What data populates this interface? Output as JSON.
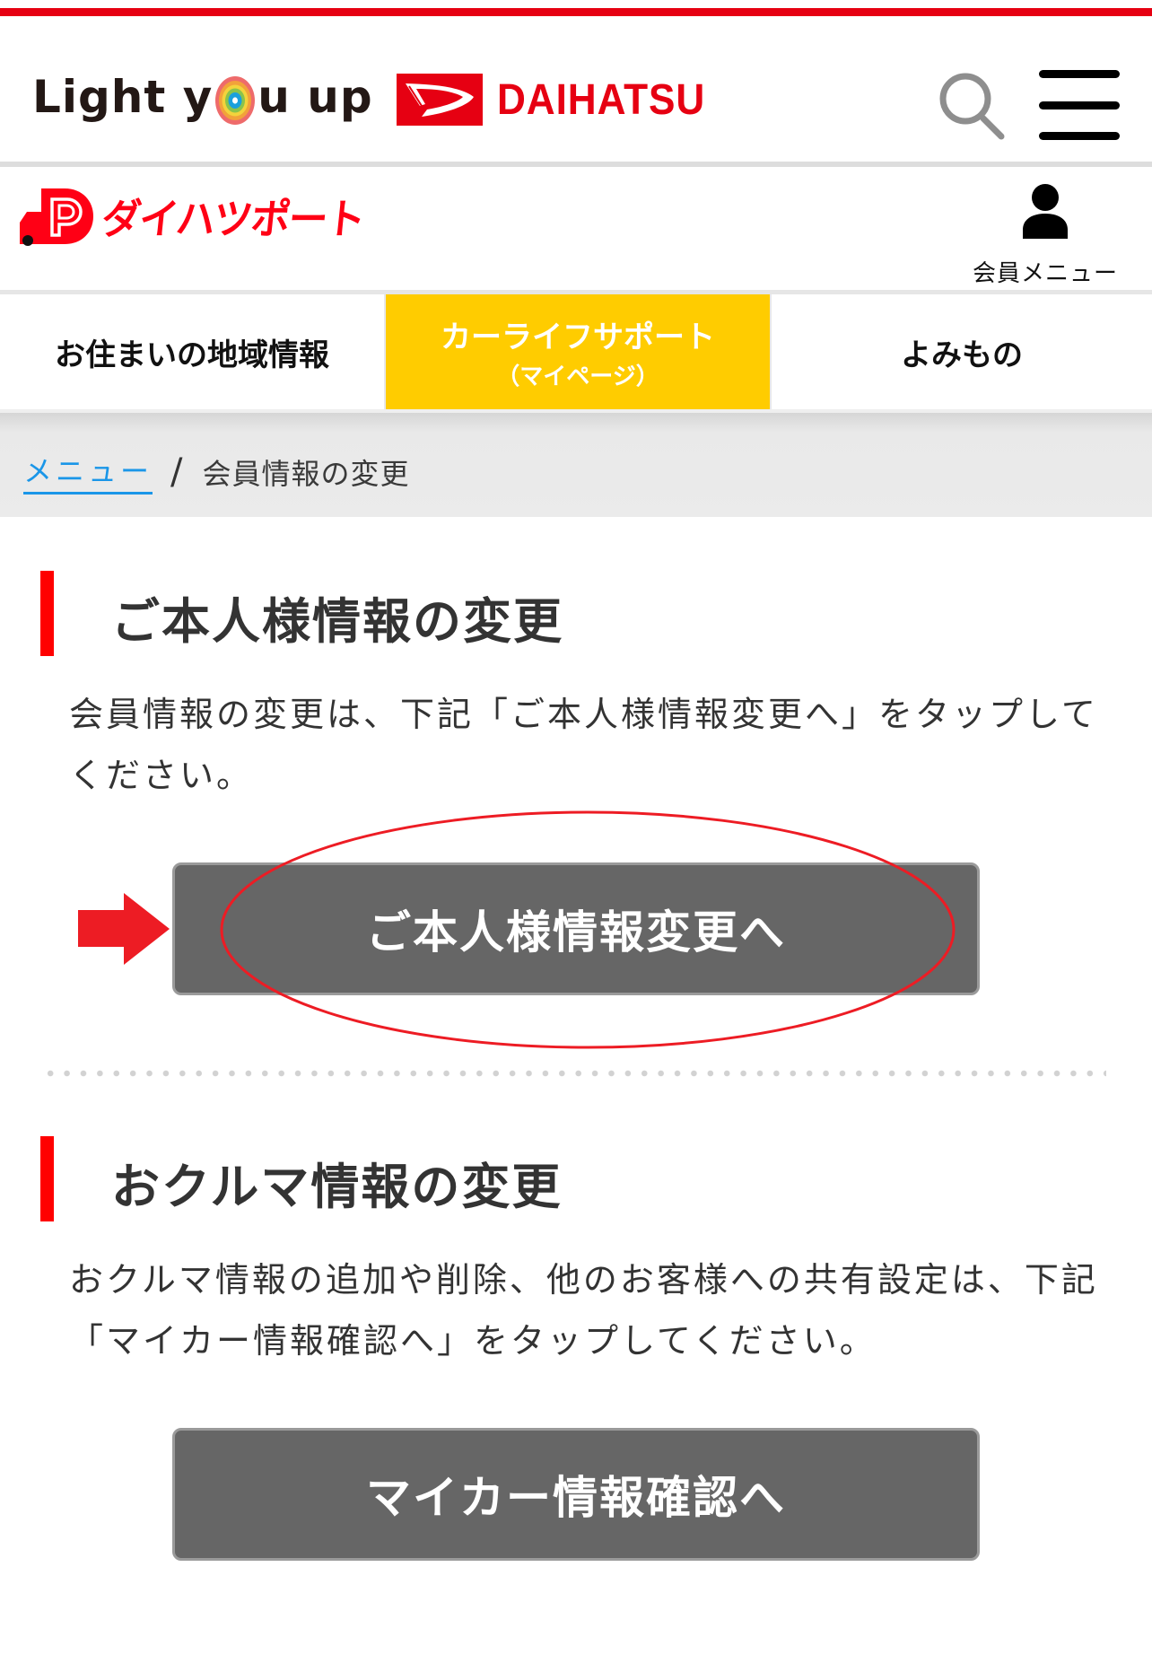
{
  "header": {
    "campaign_logo_text_before": "Light y",
    "campaign_logo_text_after": "u up",
    "brand_name": "DAIHATSU",
    "search_icon": "search-icon",
    "menu_icon": "hamburger-menu-icon"
  },
  "subheader": {
    "service_name": "ダイハツポート",
    "member_menu_label": "会員メニュー",
    "member_icon": "user-icon"
  },
  "tabs": [
    {
      "label": "お住まいの地域情報",
      "sub": "",
      "active": false
    },
    {
      "label": "カーライフサポート",
      "sub": "（マイページ）",
      "active": true
    },
    {
      "label": "よみもの",
      "sub": "",
      "active": false
    }
  ],
  "breadcrumb": {
    "link": "メニュー",
    "separator": "/",
    "current": "会員情報の変更"
  },
  "sections": [
    {
      "title": "ご本人様情報の変更",
      "text": "会員情報の変更は、下記「ご本人様情報変更へ」をタップしてください。",
      "button_label": "ご本人様情報変更へ",
      "highlighted": true
    },
    {
      "title": "おクルマ情報の変更",
      "text": "おクルマ情報の追加や削除、他のお客様への共有設定は、下記「マイカー情報確認へ」をタップしてください。",
      "button_label": "マイカー情報確認へ",
      "highlighted": false
    }
  ],
  "annotations": {
    "arrow_icon": "right-arrow-icon",
    "highlight": "red-ellipse-circle"
  },
  "colors": {
    "brand_red": "#e60012",
    "active_tab": "#ffcc00",
    "link": "#1a96e8",
    "button": "#666666",
    "section_bar": "#ff0000",
    "annotation_red": "#ed1c24"
  }
}
